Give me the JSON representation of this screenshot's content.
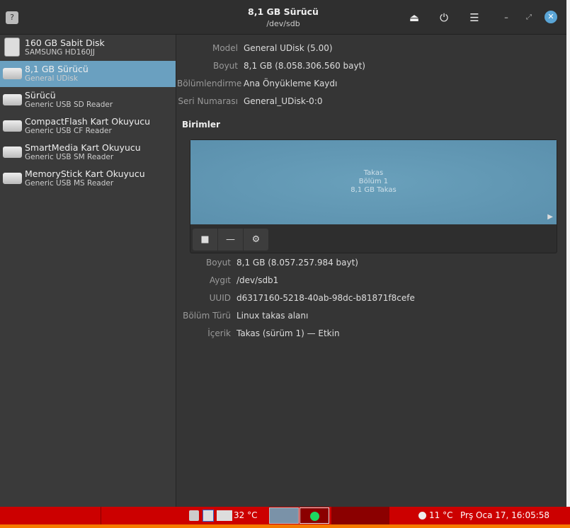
{
  "header": {
    "title": "8,1 GB Sürücü",
    "subtitle": "/dev/sdb"
  },
  "sidebar": {
    "items": [
      {
        "name": "160 GB Sabit Disk",
        "sub": "SAMSUNG HD160JJ"
      },
      {
        "name": "8,1 GB Sürücü",
        "sub": "General UDisk"
      },
      {
        "name": "Sürücü",
        "sub": "Generic USB SD Reader"
      },
      {
        "name": "CompactFlash Kart Okuyucu",
        "sub": "Generic USB CF Reader"
      },
      {
        "name": "SmartMedia Kart Okuyucu",
        "sub": "Generic USB SM Reader"
      },
      {
        "name": "MemoryStick Kart Okuyucu",
        "sub": "Generic USB MS Reader"
      }
    ]
  },
  "drive": [
    {
      "k": "Model",
      "v": "General UDisk (5.00)"
    },
    {
      "k": "Boyut",
      "v": "8,1 GB (8.058.306.560 bayt)"
    },
    {
      "k": "Bölümlendirme",
      "v": "Ana Önyükleme Kaydı"
    },
    {
      "k": "Seri Numarası",
      "v": "General_UDisk-0:0"
    }
  ],
  "volumes_heading": "Birimler",
  "partition": {
    "l1": "Takas",
    "l2": "Bölüm 1",
    "l3": "8,1 GB Takas"
  },
  "volume": [
    {
      "k": "Boyut",
      "v": "8,1 GB (8.057.257.984 bayt)"
    },
    {
      "k": "Aygıt",
      "v": "/dev/sdb1"
    },
    {
      "k": "UUID",
      "v": "d6317160-5218-40ab-98dc-b81871f8cefe"
    },
    {
      "k": "Bölüm Türü",
      "v": "Linux takas alanı"
    },
    {
      "k": "İçerik",
      "v": "Takas (sürüm 1) — Etkin"
    }
  ],
  "taskbar": {
    "cpu_temp": "32 °C",
    "weather": "11 °C",
    "clock": "Prş Oca 17, 16:05:58"
  }
}
